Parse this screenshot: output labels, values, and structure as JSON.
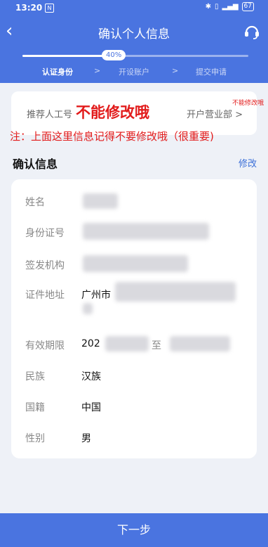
{
  "status_bar": {
    "time": "13:20",
    "badge": "N",
    "battery": "67"
  },
  "nav": {
    "title": "确认个人信息",
    "back_icon": "chevron-left-icon",
    "service_icon": "customer-service-icon"
  },
  "progress": {
    "percent_label": "40%",
    "value": 0.4,
    "steps": [
      "认证身份",
      "开设账户",
      "提交申请"
    ],
    "active_step": 0
  },
  "referrer": {
    "label": "推荐人工号",
    "branch": "开户营业部 >"
  },
  "annotations": {
    "big": "不能修改哦",
    "small": "不能修改哦",
    "note": "注：上面这里信息记得不要修改哦（很重要)"
  },
  "section": {
    "title": "确认信息",
    "edit": "修改"
  },
  "info": {
    "name_label": "姓名",
    "id_label": "身份证号",
    "issuer_label": "签发机构",
    "address_label": "证件地址",
    "address_value": "广州市",
    "validity_label": "有效期限",
    "validity_value": "202",
    "validity_to": "至",
    "ethnicity_label": "民族",
    "ethnicity_value": "汉族",
    "nationality_label": "国籍",
    "nationality_value": "中国",
    "gender_label": "性别",
    "gender_value": "男"
  },
  "footer": {
    "next": "下一步"
  },
  "colors": {
    "brand": "#4a74e0",
    "annotation": "#e21b1b",
    "link": "#3b6fd8"
  }
}
